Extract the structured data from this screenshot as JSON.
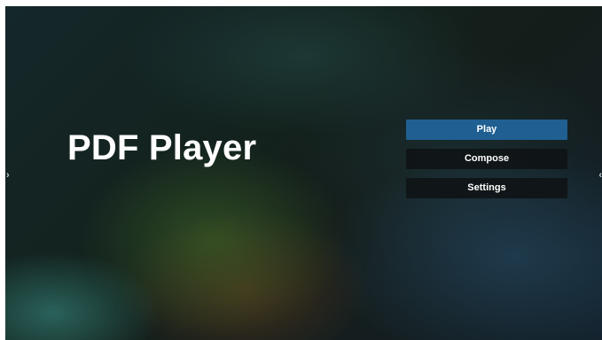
{
  "app": {
    "title": "PDF Player"
  },
  "menu": {
    "items": [
      {
        "label": "Play",
        "selected": true
      },
      {
        "label": "Compose",
        "selected": false
      },
      {
        "label": "Settings",
        "selected": false
      }
    ]
  },
  "nav": {
    "left_icon": "chevron-right-icon",
    "right_icon": "chevron-left-icon",
    "left_glyph": "›",
    "right_glyph": "‹"
  },
  "colors": {
    "selected_button": "#1f5f92",
    "button": "#0f1214",
    "text": "#ffffff"
  }
}
